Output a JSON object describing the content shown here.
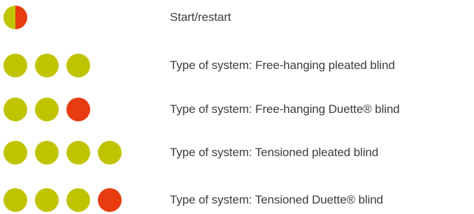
{
  "colors": {
    "olive": "#c0c400",
    "red": "#e83b0f",
    "text": "#3c3c3c"
  },
  "legend": {
    "rows": [
      {
        "label": "Start/restart",
        "indicator": "one half-olive half-red dot"
      },
      {
        "label": "Type of system: Free-hanging pleated blind",
        "indicator": "three olive dots"
      },
      {
        "label": "Type of system: Free-hanging Duette® blind",
        "indicator": "two olive dots, one red dot"
      },
      {
        "label": "Type of system: Tensioned pleated blind",
        "indicator": "four olive dots"
      },
      {
        "label": "Type of system: Tensioned Duette® blind",
        "indicator": "three olive dots, one red dot"
      }
    ]
  }
}
